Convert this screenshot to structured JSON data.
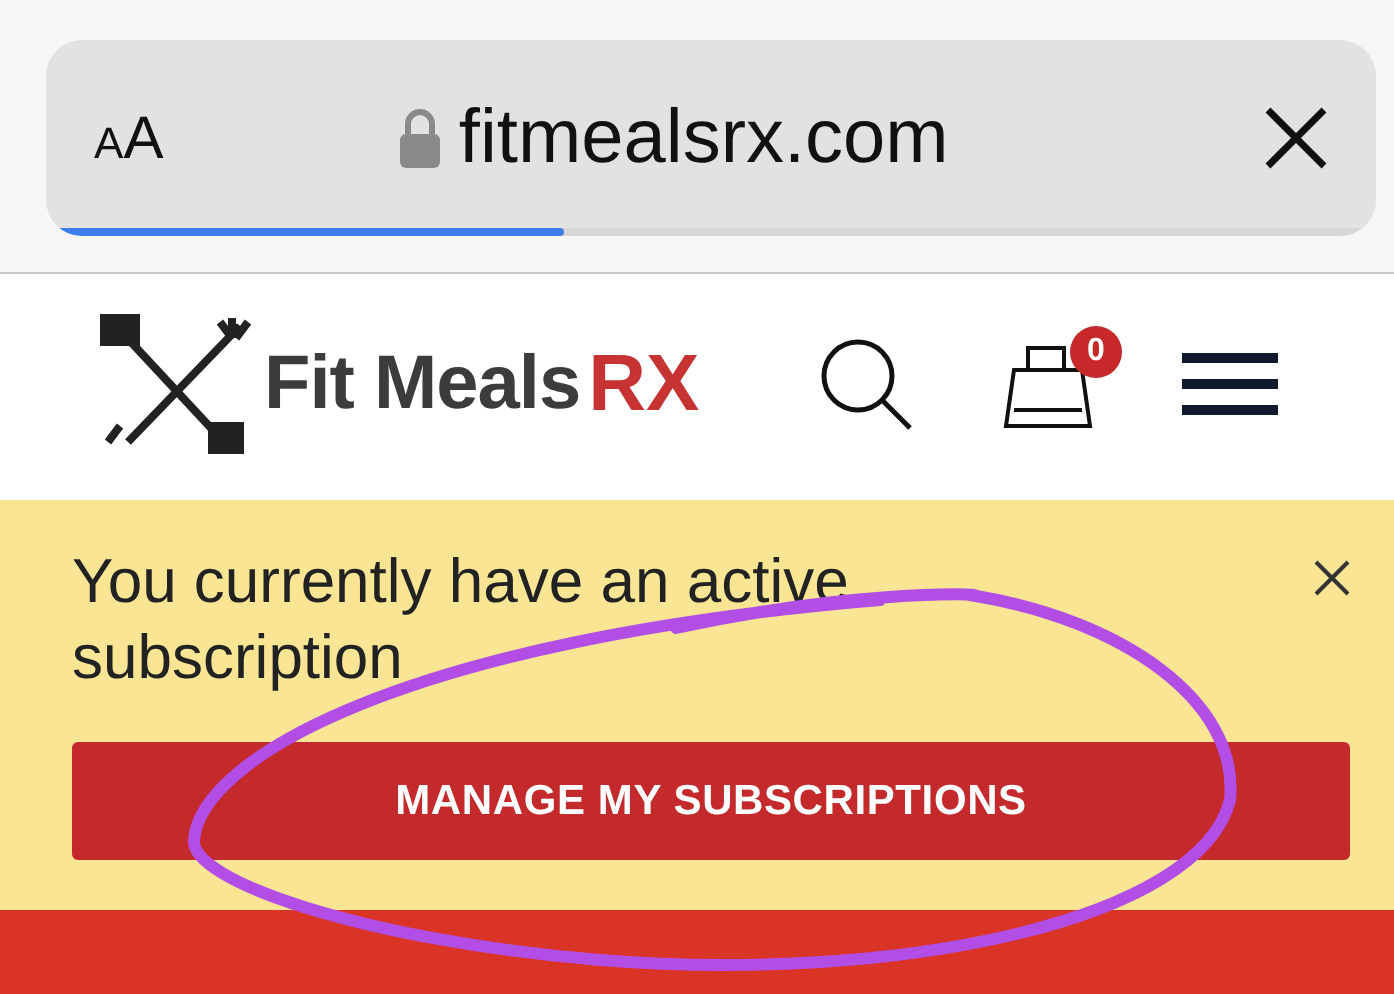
{
  "browser_bar": {
    "text_size_button": "AA",
    "url": "fitmealsrx.com",
    "load_progress": {
      "level": 0.39
    }
  },
  "header": {
    "logo_text": "Fit Meals",
    "logo_accent": "RX",
    "cart_count": "0"
  },
  "notice": {
    "message": "You currently have an active subscription",
    "button": "MANAGE MY SUBSCRIPTIONS"
  }
}
